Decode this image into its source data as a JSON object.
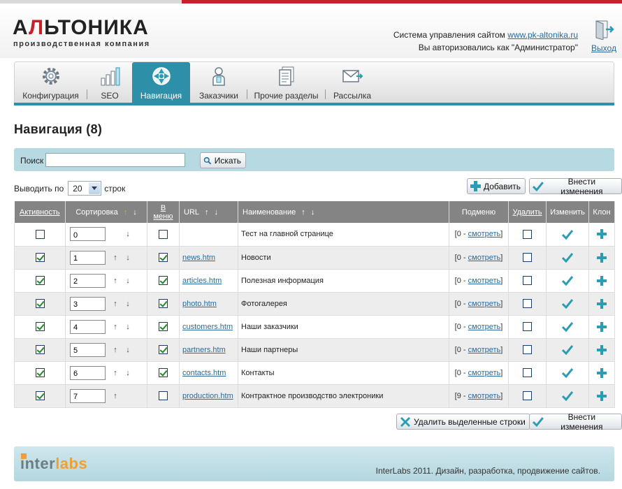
{
  "logo": {
    "main_a": "Л",
    "main_b": "ЬТОНИКА",
    "main_first": "А",
    "sub": "производственная компания"
  },
  "header": {
    "cms_text": "Система управления сайтом",
    "cms_link": "www.pk-altonika.ru",
    "auth_text": "Вы авторизовались как \"Администратор\"",
    "exit_label": "Выход"
  },
  "tabs": [
    {
      "label": "Конфигурация",
      "icon": "gear-icon"
    },
    {
      "label": "SEO",
      "icon": "bar-chart-icon"
    },
    {
      "label": "Навигация",
      "icon": "navigation-icon",
      "active": true
    },
    {
      "label": "Заказчики",
      "icon": "person-icon"
    },
    {
      "label": "Прочие разделы",
      "icon": "document-icon"
    },
    {
      "label": "Рассылка",
      "icon": "envelope-icon"
    }
  ],
  "page_title": "Навигация (8)",
  "search": {
    "label": "Поиск",
    "value": "",
    "button": "Искать"
  },
  "per_page": {
    "label_before": "Выводить по",
    "value": "20",
    "label_after": "строк"
  },
  "buttons": {
    "add": "Добавить",
    "save": "Внести изменения",
    "delete_selected": "Удалить выделенные строки"
  },
  "table": {
    "headers": {
      "active": "Активность",
      "sort": "Сортировка",
      "in_menu": "В меню",
      "url": "URL",
      "name": "Наименование",
      "submenu": "Подменю",
      "delete": "Удалить",
      "edit": "Изменить",
      "clone": "Клон"
    },
    "rows": [
      {
        "active": false,
        "sort": "0",
        "up": false,
        "down": true,
        "in_menu": false,
        "url": "",
        "name": "Тест на главной странице",
        "sub_count": "0",
        "sub_link": "смотреть"
      },
      {
        "active": true,
        "sort": "1",
        "up": true,
        "down": true,
        "in_menu": true,
        "url": "news.htm",
        "name": "Новости",
        "sub_count": "0",
        "sub_link": "смотреть"
      },
      {
        "active": true,
        "sort": "2",
        "up": true,
        "down": true,
        "in_menu": true,
        "url": "articles.htm",
        "name": "Полезная информация",
        "sub_count": "0",
        "sub_link": "смотреть"
      },
      {
        "active": true,
        "sort": "3",
        "up": true,
        "down": true,
        "in_menu": true,
        "url": "photo.htm",
        "name": "Фотогалерея",
        "sub_count": "0",
        "sub_link": "смотреть"
      },
      {
        "active": true,
        "sort": "4",
        "up": true,
        "down": true,
        "in_menu": true,
        "url": "customers.htm",
        "name": "Наши заказчики",
        "sub_count": "0",
        "sub_link": "смотреть"
      },
      {
        "active": true,
        "sort": "5",
        "up": true,
        "down": true,
        "in_menu": true,
        "url": "partners.htm",
        "name": "Наши партнеры",
        "sub_count": "0",
        "sub_link": "смотреть"
      },
      {
        "active": true,
        "sort": "6",
        "up": true,
        "down": true,
        "in_menu": true,
        "url": "contacts.htm",
        "name": "Контакты",
        "sub_count": "0",
        "sub_link": "смотреть"
      },
      {
        "active": true,
        "sort": "7",
        "up": true,
        "down": false,
        "in_menu": false,
        "url": "production.htm",
        "name": "Контрактное производство электроники",
        "sub_count": "9",
        "sub_link": "смотреть"
      }
    ]
  },
  "footer": {
    "brand_a": "inter",
    "brand_b": "labs",
    "text": "InterLabs 2011. Дизайн, разработка, продвижение сайтов."
  },
  "colors": {
    "accent_red": "#c8202b",
    "tab_active": "#2e90a8",
    "search_bar": "#b7d9e2",
    "icon_teal": "#2a9db5",
    "footer_orange": "#f0a030"
  }
}
